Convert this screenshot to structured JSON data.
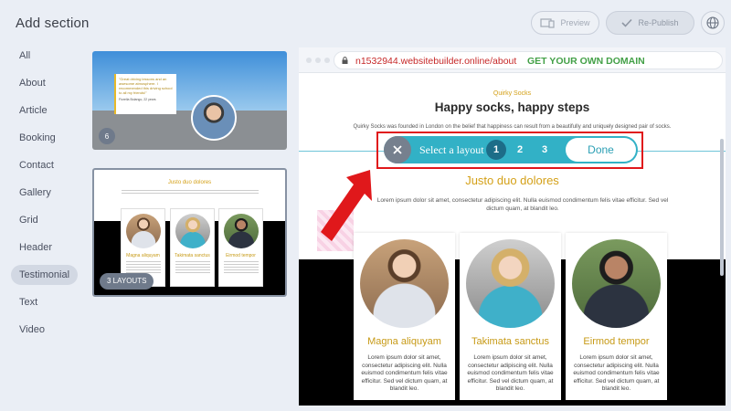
{
  "header": {
    "title": "Add section",
    "preview_label": "Preview",
    "republish_label": "Re-Publish"
  },
  "sidebar": {
    "items": [
      {
        "label": "All"
      },
      {
        "label": "About"
      },
      {
        "label": "Article"
      },
      {
        "label": "Booking"
      },
      {
        "label": "Contact"
      },
      {
        "label": "Gallery"
      },
      {
        "label": "Grid"
      },
      {
        "label": "Header"
      },
      {
        "label": "Testimonial",
        "active": true
      },
      {
        "label": "Text"
      },
      {
        "label": "Video"
      }
    ]
  },
  "thumbnails": [
    {
      "quote": "\"Great driving lessons and an awesome atmosphere. I recommended this driving school to all my friends!\"",
      "author": "Fiorella Bolango, 22 years",
      "badge": "6"
    },
    {
      "title": "Justo duo dolores",
      "cards": [
        "Magna aliquyam",
        "Takimata sanctus",
        "Eirmod tempor"
      ],
      "badge": "3 LAYOUTS"
    }
  ],
  "browser": {
    "url": "n1532944.websitebuilder.online/about",
    "cta": "GET YOUR OWN DOMAIN"
  },
  "preview": {
    "kicker": "Quirky Socks",
    "title": "Happy socks, happy steps",
    "description": "Quirky Socks was founded in London on the belief that happiness can result from a beautifully and uniquely designed pair of socks.",
    "section_title": "Justo duo dolores",
    "section_desc": "Lorem ipsum dolor sit amet, consectetur adipiscing elit. Nulla euismod condimentum felis vitae efficitur. Sed vel dictum quam, at blandit leo.",
    "cards": [
      {
        "name": "Magna aliquyam",
        "text": "Lorem ipsum dolor sit amet, consectetur adipiscing elit. Nulla euismod condimentum felis vitae efficitur. Sed vel dictum quam, at blandit leo."
      },
      {
        "name": "Takimata sanctus",
        "text": "Lorem ipsum dolor sit amet, consectetur adipiscing elit. Nulla euismod condimentum felis vitae efficitur. Sed vel dictum quam, at blandit leo."
      },
      {
        "name": "Eirmod tempor",
        "text": "Lorem ipsum dolor sit amet, consectetur adipiscing elit. Nulla euismod condimentum felis vitae efficitur. Sed vel dictum quam, at blandit leo."
      }
    ]
  },
  "layout_bar": {
    "label": "Select a layout",
    "options": [
      "1",
      "2",
      "3"
    ],
    "active": "1",
    "done_label": "Done"
  },
  "colors": {
    "accent": "#32b1c6",
    "gold": "#d4a017",
    "highlight": "#e0181b"
  },
  "icons": [
    "monitor-phone-icon",
    "check-icon",
    "globe-icon",
    "lock-icon",
    "close-icon",
    "arrow-pointer-icon"
  ]
}
